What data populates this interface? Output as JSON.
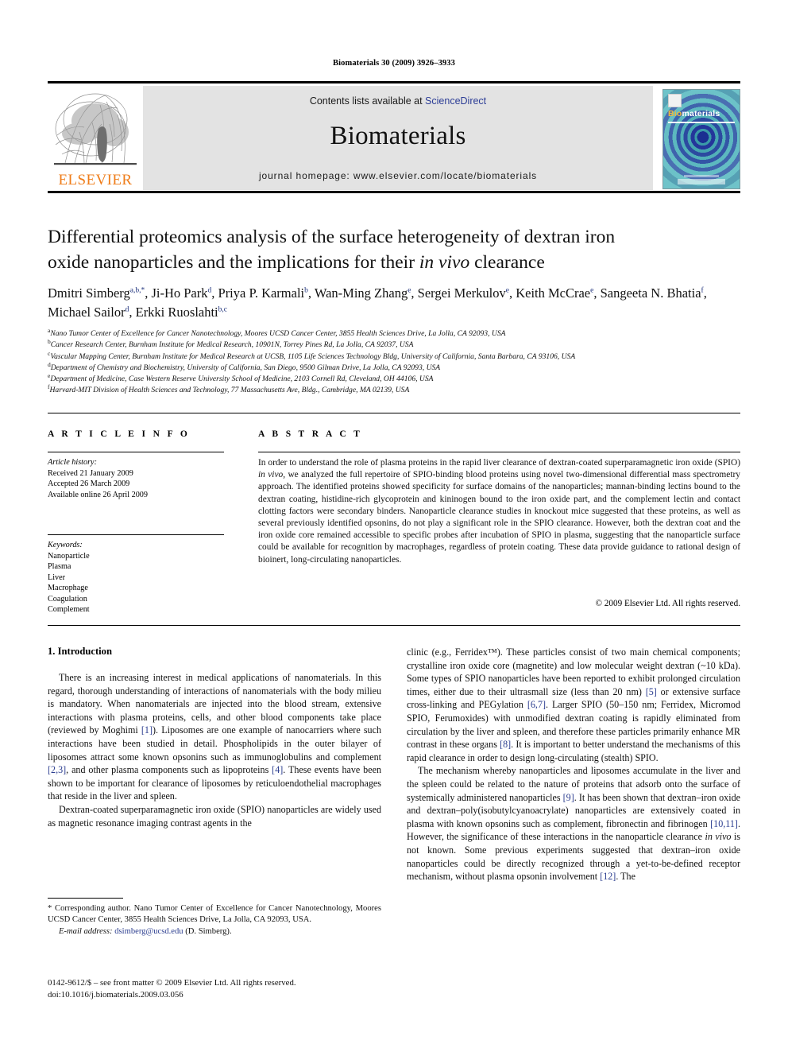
{
  "running_head": "Biomaterials 30 (2009) 3926–3933",
  "masthead": {
    "elsevier_wordmark": "ELSEVIER",
    "elsevier_logo_color": "#ef7d1a",
    "contents_prefix": "Contents lists available at ",
    "contents_link": "ScienceDirect",
    "contents_link_color": "#2c3d96",
    "journal_name": "Biomaterials",
    "homepage": "journal homepage: www.elsevier.com/locate/biomaterials",
    "cover": {
      "title_first": "Bio",
      "title_rest": "materials",
      "title_accent_color": "#f0b93a"
    }
  },
  "title": {
    "line1": "Differential proteomics analysis of the surface heterogeneity of dextran iron",
    "line2_pre": "oxide nanoparticles and the implications for their ",
    "line2_italic": "in vivo",
    "line2_post": " clearance"
  },
  "authors": [
    {
      "name": "Dmitri Simberg",
      "sup": "a,b,*"
    },
    {
      "name": "Ji-Ho Park",
      "sup": "d"
    },
    {
      "name": "Priya P. Karmali",
      "sup": "b"
    },
    {
      "name": "Wan-Ming Zhang",
      "sup": "e"
    },
    {
      "name": "Sergei Merkulov",
      "sup": "e"
    },
    {
      "name": "Keith McCrae",
      "sup": "e"
    },
    {
      "name": "Sangeeta N. Bhatia",
      "sup": "f"
    },
    {
      "name": "Michael Sailor",
      "sup": "d"
    },
    {
      "name": "Erkki Ruoslahti",
      "sup": "b,c"
    }
  ],
  "affiliations": [
    {
      "mark": "a",
      "text": "Nano Tumor Center of Excellence for Cancer Nanotechnology, Moores UCSD Cancer Center, 3855 Health Sciences Drive, La Jolla, CA 92093, USA"
    },
    {
      "mark": "b",
      "text": "Cancer Research Center, Burnham Institute for Medical Research, 10901N, Torrey Pines Rd, La Jolla, CA 92037, USA"
    },
    {
      "mark": "c",
      "text": "Vascular Mapping Center, Burnham Institute for Medical Research at UCSB, 1105 Life Sciences Technology Bldg, University of California, Santa Barbara, CA 93106, USA"
    },
    {
      "mark": "d",
      "text": "Department of Chemistry and Biochemistry, University of California, San Diego, 9500 Gilman Drive, La Jolla, CA 92093, USA"
    },
    {
      "mark": "e",
      "text": "Department of Medicine, Case Western Reserve University School of Medicine, 2103 Cornell Rd, Cleveland, OH 44106, USA"
    },
    {
      "mark": "f",
      "text": "Harvard-MIT Division of Health Sciences and Technology, 77 Massachusetts Ave, Bldg., Cambridge, MA 02139, USA"
    }
  ],
  "info": {
    "heading": "A R T I C L E  I N F O",
    "history_label": "Article history:",
    "history": [
      "Received 21 January 2009",
      "Accepted 26 March 2009",
      "Available online 26 April 2009"
    ],
    "keywords_label": "Keywords:",
    "keywords": [
      "Nanoparticle",
      "Plasma",
      "Liver",
      "Macrophage",
      "Coagulation",
      "Complement"
    ]
  },
  "abstract": {
    "heading": "A B S T R A C T",
    "part1": "In order to understand the role of plasma proteins in the rapid liver clearance of dextran-coated superparamagnetic iron oxide (SPIO) ",
    "italic1": "in vivo",
    "part2": ", we analyzed the full repertoire of SPIO-binding blood proteins using novel two-dimensional differential mass spectrometry approach. The identified proteins showed specificity for surface domains of the nanoparticles; mannan-binding lectins bound to the dextran coating, histidine-rich glycoprotein and kininogen bound to the iron oxide part, and the complement lectin and contact clotting factors were secondary binders. Nanoparticle clearance studies in knockout mice suggested that these proteins, as well as several previously identified opsonins, do not play a significant role in the SPIO clearance. However, both the dextran coat and the iron oxide core remained accessible to specific probes after incubation of SPIO in plasma, suggesting that the nanoparticle surface could be available for recognition by macrophages, regardless of protein coating. These data provide guidance to rational design of bioinert, long-circulating nanoparticles.",
    "copyright": "© 2009 Elsevier Ltd. All rights reserved."
  },
  "body": {
    "section_number_title": "1.  Introduction",
    "left_paragraphs": [
      {
        "segments": [
          {
            "t": "There is an increasing interest in medical applications of nanomaterials. In this regard, thorough understanding of interactions of nanomaterials with the body milieu is mandatory. When nanomaterials are injected into the blood stream, extensive interactions with plasma proteins, cells, and other blood components take place (reviewed by Moghimi "
          },
          {
            "t": "[1]",
            "k": "ref"
          },
          {
            "t": "). Liposomes are one example of nanocarriers where such interactions have been studied in detail. Phospholipids in the outer bilayer of liposomes attract some known opsonins such as immunoglobulins and complement "
          },
          {
            "t": "[2,3]",
            "k": "ref"
          },
          {
            "t": ", and other plasma components such as lipoproteins "
          },
          {
            "t": "[4]",
            "k": "ref"
          },
          {
            "t": ". These events have been shown to be important for clearance of liposomes by reticuloendothelial macrophages that reside in the liver and spleen."
          }
        ]
      },
      {
        "segments": [
          {
            "t": "Dextran-coated superparamagnetic iron oxide (SPIO) nanoparticles are widely used as magnetic resonance imaging contrast agents in the"
          }
        ]
      }
    ],
    "right_paragraphs": [
      {
        "noindent": true,
        "segments": [
          {
            "t": "clinic (e.g., Ferridex™). These particles consist of two main chemical components; crystalline iron oxide core (magnetite) and low molecular weight dextran (~10 kDa). Some types of SPIO nanoparticles have been reported to exhibit prolonged circulation times, either due to their ultrasmall size (less than 20 nm) "
          },
          {
            "t": "[5]",
            "k": "ref"
          },
          {
            "t": " or extensive surface cross-linking and PEGylation "
          },
          {
            "t": "[6,7]",
            "k": "ref"
          },
          {
            "t": ". Larger SPIO (50–150 nm; Ferridex, Micromod SPIO, Ferumoxides) with unmodified dextran coating is rapidly eliminated from circulation by the liver and spleen, and therefore these particles primarily enhance MR contrast in these organs "
          },
          {
            "t": "[8]",
            "k": "ref"
          },
          {
            "t": ". It is important to better understand the mechanisms of this rapid clearance in order to design long-circulating (stealth) SPIO."
          }
        ]
      },
      {
        "segments": [
          {
            "t": "The mechanism whereby nanoparticles and liposomes accumulate in the liver and the spleen could be related to the nature of proteins that adsorb onto the surface of systemically administered nanoparticles "
          },
          {
            "t": "[9]",
            "k": "ref"
          },
          {
            "t": ". It has been shown that dextran–iron oxide and dextran–poly(isobutylcyanoacrylate) nanoparticles are extensively coated in plasma with known opsonins such as complement, fibronectin and fibrinogen "
          },
          {
            "t": "[10,11]",
            "k": "ref"
          },
          {
            "t": ". However, the significance of these interactions in the nanoparticle clearance "
          },
          {
            "t": "in vivo",
            "k": "it"
          },
          {
            "t": " is not known. Some previous experiments suggested that dextran–iron oxide nanoparticles could be directly recognized through a yet-to-be-defined receptor mechanism, without plasma opsonin involvement "
          },
          {
            "t": "[12]",
            "k": "ref"
          },
          {
            "t": ". The"
          }
        ]
      }
    ]
  },
  "footnote": {
    "corresponding": "*  Corresponding author. Nano Tumor Center of Excellence for Cancer Nanotechnology, Moores UCSD Cancer Center, 3855 Health Sciences Drive, La Jolla, CA 92093, USA.",
    "email_label": "E-mail address:",
    "email": "dsimberg@ucsd.edu",
    "email_suffix": " (D. Simberg).",
    "email_color": "#2b3d8f"
  },
  "frontmatter": {
    "line1": "0142-9612/$ – see front matter © 2009 Elsevier Ltd. All rights reserved.",
    "line2": "doi:10.1016/j.biomaterials.2009.03.056"
  }
}
